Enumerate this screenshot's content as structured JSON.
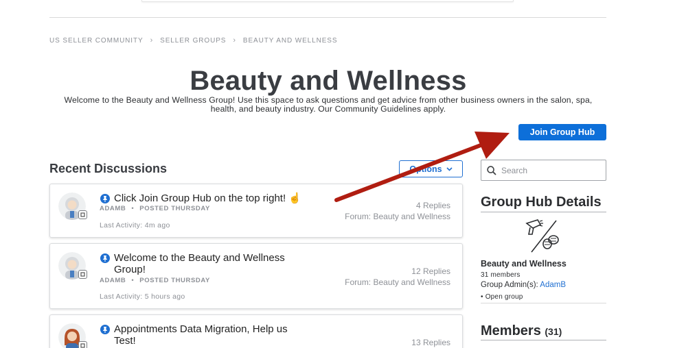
{
  "breadcrumb": {
    "items": [
      "US SELLER COMMUNITY",
      "SELLER GROUPS",
      "BEAUTY AND WELLNESS"
    ],
    "separator": "›"
  },
  "header": {
    "title": "Beauty and Wellness",
    "description": "Welcome to the Beauty and Wellness Group! Use this space to ask questions and get advice from other business owners in the salon, spa, health, and beauty industry. Our Community Guidelines apply.",
    "join_button": "Join Group Hub"
  },
  "discussions": {
    "title": "Recent Discussions",
    "options_label": "Options",
    "posts": [
      {
        "title": "Click Join Group Hub on the top right! ☝️",
        "author": "ADAMB",
        "posted": "POSTED THURSDAY",
        "activity": "Last Activity: 4m ago",
        "replies": "4 Replies",
        "forum": "Forum: Beauty and Wellness"
      },
      {
        "title": "Welcome to the Beauty and Wellness Group!",
        "author": "ADAMB",
        "posted": "POSTED THURSDAY",
        "activity": "Last Activity: 5 hours ago",
        "replies": "12 Replies",
        "forum": "Forum: Beauty and Wellness"
      },
      {
        "title": "Appointments Data Migration, Help us Test!",
        "replies": "13 Replies"
      }
    ]
  },
  "search": {
    "placeholder": "Search"
  },
  "group_details": {
    "title": "Group Hub Details",
    "name": "Beauty and Wellness",
    "members": "31 members",
    "admin_label": "Group Admin(s):",
    "admin_name": "AdamB",
    "type": "Open group"
  },
  "members": {
    "title": "Members",
    "count": "(31)"
  },
  "colors": {
    "primary_blue": "#0d6fd9",
    "arrow_red": "#b01d11"
  }
}
